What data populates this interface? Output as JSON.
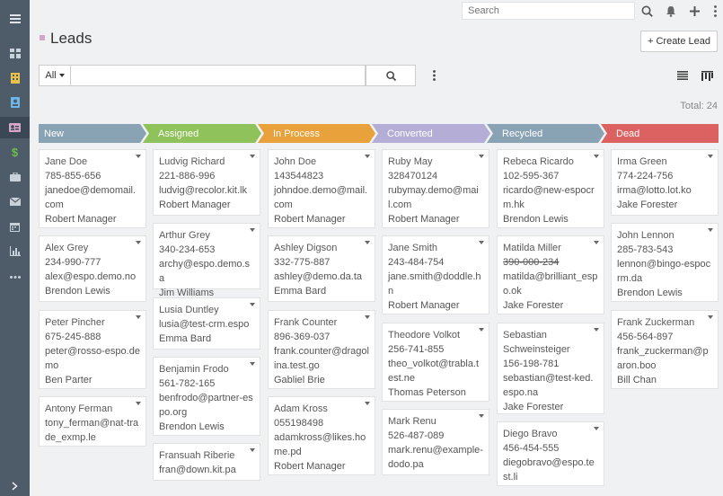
{
  "search": {
    "placeholder": "Search"
  },
  "page": {
    "title": "Leads",
    "create_label": "+ Create Lead",
    "filter_all": "All",
    "total": "Total: 24"
  },
  "colors": {
    "new": "#8aa3b4",
    "assigned": "#8fc25a",
    "in_process": "#e9a23b",
    "converted": "#b4aed7",
    "recycled": "#8aa3b4",
    "dead": "#dc6262",
    "sidebar": "#4e5b68"
  },
  "columns": [
    {
      "label": "New",
      "cards": [
        {
          "name": "Jane Doe",
          "phone": "785-855-656",
          "email": "janedoe@demomail.com",
          "user": "Robert Manager"
        },
        {
          "name": "Alex Grey",
          "phone": "234-990-777",
          "email": "alex@espo.demo.no",
          "user": "Brendon Lewis"
        },
        {
          "name": "Peter Pincher",
          "phone": "675-245-888",
          "email": "peter@rosso-espo.demo",
          "user": "Ben Parter"
        },
        {
          "name": "Antony Ferman",
          "phone": "",
          "email": "tony_ferman@nat-trade_exmp.le",
          "user": ""
        }
      ]
    },
    {
      "label": "Assigned",
      "cards": [
        {
          "name": "Ludvig Richard",
          "phone": "221-886-996",
          "email": "ludvig@recolor.kit.lk",
          "user": "Robert Manager"
        },
        {
          "name": "Arthur Grey",
          "phone": "340-234-653",
          "email": "archy@espo.demo.sa",
          "user": "Jim Williams"
        },
        {
          "name": "Lusia Duntley",
          "phone": "",
          "email": "lusia@test-crm.espo",
          "user": "Emma Bard"
        },
        {
          "name": "Benjamin Frodo",
          "phone": "561-782-165",
          "email": "benfrodo@partner-espo.org",
          "user": "Brendon Lewis"
        },
        {
          "name": "Fransuah Riberie",
          "phone": "",
          "email": "fran@down.kit.pa",
          "user": ""
        }
      ]
    },
    {
      "label": "In Process",
      "cards": [
        {
          "name": "John Doe",
          "phone": "143544823",
          "email": "johndoe.demo@mail.com",
          "user": "Robert Manager"
        },
        {
          "name": "Ashley Digson",
          "phone": "332-775-887",
          "email": "ashley@demo.da.ta",
          "user": "Emma Bard"
        },
        {
          "name": "Frank Counter",
          "phone": "896-369-037",
          "email": "frank.counter@dragolina.test.go",
          "user": "Gabliel Brie"
        },
        {
          "name": "Adam Kross",
          "phone": "055198498",
          "email": "adamkross@likes.home.pd",
          "user": "Robert Manager"
        }
      ]
    },
    {
      "label": "Converted",
      "cards": [
        {
          "name": "Ruby May",
          "phone": "328470124",
          "email": "rubymay.demo@mail.com",
          "user": "Robert Manager"
        },
        {
          "name": "Jane Smith",
          "phone": "243-484-754",
          "email": "jane.smith@doddle.hn",
          "user": "Robert Manager"
        },
        {
          "name": "Theodore Volkot",
          "phone": "256-741-855",
          "email": "theo_volkot@trabla.test.ne",
          "user": "Thomas Peterson"
        },
        {
          "name": "Mark Renu",
          "phone": "526-487-089",
          "email": "mark.renu@example-dodo.pa",
          "user": ""
        }
      ]
    },
    {
      "label": "Recycled",
      "cards": [
        {
          "name": "Rebeca Ricardo",
          "phone": "102-595-367",
          "email": "ricardo@new-espocrm.hk",
          "user": "Brendon Lewis"
        },
        {
          "name": "Matilda Miller",
          "phone": "390-000-234",
          "email": "matilda@brilliant_espo.ok",
          "user": "Jake Forester"
        },
        {
          "name": "Sebastian Schweinsteiger",
          "phone": "156-198-781",
          "email": "sebastian@test-ked.espo.na",
          "user": "Jake Forester"
        },
        {
          "name": "Diego Bravo",
          "phone": "456-454-555",
          "email": "diegobravo@espo.test.li",
          "user": ""
        }
      ]
    },
    {
      "label": "Dead",
      "cards": [
        {
          "name": "Irma Green",
          "phone": "774-224-756",
          "email": "irma@lotto.lot.ko",
          "user": "Jake Forester"
        },
        {
          "name": "John Lennon",
          "phone": "285-783-543",
          "email": "lennon@bingo-espocrm.da",
          "user": "Brendon Lewis"
        },
        {
          "name": "Frank Zuckerman",
          "phone": "456-564-897",
          "email": "frank_zuckerman@paron.boo",
          "user": "Bill Chan"
        }
      ]
    }
  ]
}
